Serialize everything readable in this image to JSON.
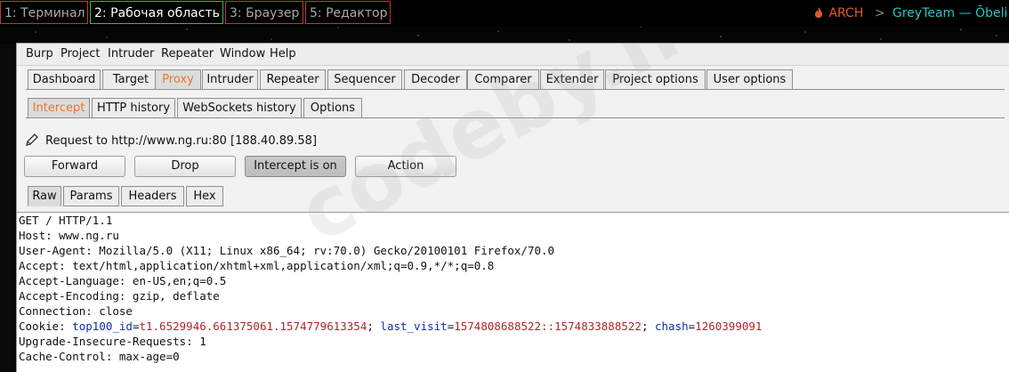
{
  "topbar": {
    "workspaces": [
      {
        "label": "1: Терминал",
        "active": false
      },
      {
        "label": "2: Рабочая область",
        "active": true
      },
      {
        "label": "3: Браузер",
        "active": false
      },
      {
        "label": "5: Редактор",
        "active": false
      }
    ],
    "arch_label": "ARCH",
    "separator": ">",
    "team_label": "GreyTeam — Ōbeli"
  },
  "menubar": {
    "items": [
      "Burp",
      "Project",
      "Intruder",
      "Repeater",
      "Window",
      "Help"
    ]
  },
  "main_tabs": [
    "Dashboard",
    "Target",
    "Proxy",
    "Intruder",
    "Repeater",
    "Sequencer",
    "Decoder",
    "Comparer",
    "Extender",
    "Project options",
    "User options"
  ],
  "main_tab_selected": "Proxy",
  "proxy_tabs": [
    "Intercept",
    "HTTP history",
    "WebSockets history",
    "Options"
  ],
  "proxy_tab_selected": "Intercept",
  "request_info": "Request to http://www.ng.ru:80  [188.40.89.58]",
  "buttons": {
    "forward": "Forward",
    "drop": "Drop",
    "intercept": "Intercept is on",
    "action": "Action"
  },
  "view_tabs": [
    "Raw",
    "Params",
    "Headers",
    "Hex"
  ],
  "view_tab_selected": "Raw",
  "request": {
    "lines": [
      "GET / HTTP/1.1",
      "Host: www.ng.ru",
      "User-Agent: Mozilla/5.0 (X11; Linux x86_64; rv:70.0) Gecko/20100101 Firefox/70.0",
      "Accept: text/html,application/xhtml+xml,application/xml;q=0.9,*/*;q=0.8",
      "Accept-Language: en-US,en;q=0.5",
      "Accept-Encoding: gzip, deflate",
      "Connection: close"
    ],
    "cookie": {
      "prefix": "Cookie: ",
      "pairs": [
        {
          "name": "top100_id",
          "value": "t1.6529946.661375061.1574779613354"
        },
        {
          "name": "last_visit",
          "value": "1574808688522::1574833888522"
        },
        {
          "name": "chash",
          "value": "1260399091"
        }
      ],
      "pair_separator": "; ",
      "eq": "="
    },
    "lines_after": [
      "Upgrade-Insecure-Requests: 1",
      "Cache-Control: max-age=0"
    ]
  },
  "watermark": "codeby.net",
  "colors": {
    "selected_tab_text": "#e8762b",
    "cookie_name": "#0b2ea8",
    "cookie_value": "#b0252b",
    "workspace_border": "#c0392b",
    "workspace_active_border": "#4caf50"
  }
}
